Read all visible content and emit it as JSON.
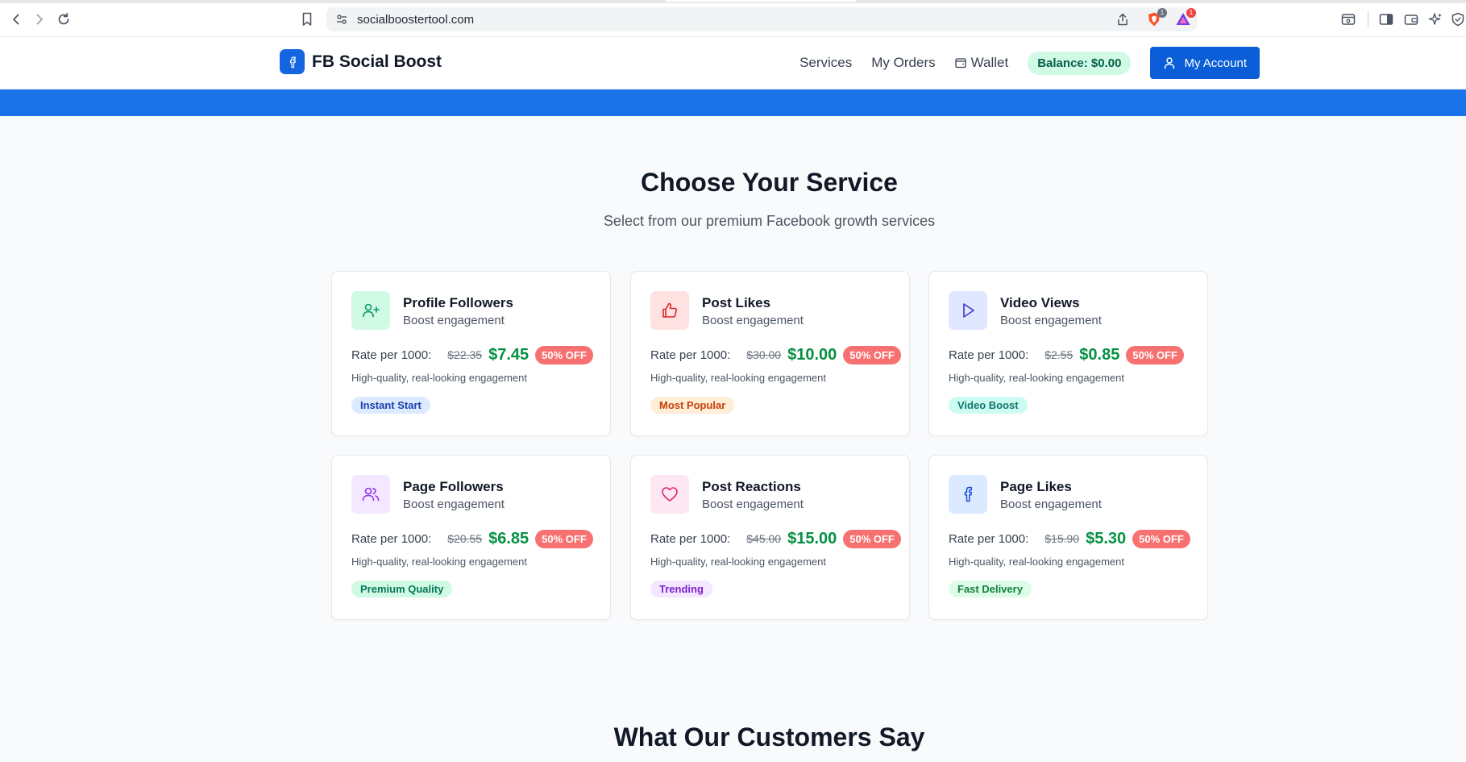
{
  "browser": {
    "url": "socialboostertool.com",
    "extension_badges": [
      "1",
      "1"
    ]
  },
  "site": {
    "brand": "FB Social Boost",
    "nav": {
      "services": "Services",
      "orders": "My Orders",
      "wallet": "Wallet",
      "balance": "Balance: $0.00",
      "account": "My Account"
    }
  },
  "services_section": {
    "title": "Choose Your Service",
    "subtitle": "Select from our premium Facebook growth services",
    "rate_label": "Rate per 1000:",
    "cards": [
      {
        "name": "Profile Followers",
        "desc": "Boost engagement",
        "old_price": "$22.35",
        "new_price": "$7.45",
        "discount": "50% OFF",
        "note": "High-quality, real-looking engagement",
        "tag": "Instant Start",
        "icon": "user-plus-icon",
        "icon_bg": "#d1fae5",
        "icon_color": "#059669",
        "tag_bg": "#dbeafe",
        "tag_color": "#1e40af"
      },
      {
        "name": "Post Likes",
        "desc": "Boost engagement",
        "old_price": "$30.00",
        "new_price": "$10.00",
        "discount": "50% OFF",
        "note": "High-quality, real-looking engagement",
        "tag": "Most Popular",
        "icon": "thumbs-up-icon",
        "icon_bg": "#fee2e2",
        "icon_color": "#dc2626",
        "tag_bg": "#ffedd5",
        "tag_color": "#c2410c"
      },
      {
        "name": "Video Views",
        "desc": "Boost engagement",
        "old_price": "$2.55",
        "new_price": "$0.85",
        "discount": "50% OFF",
        "note": "High-quality, real-looking engagement",
        "tag": "Video Boost",
        "icon": "play-icon",
        "icon_bg": "#e0e7ff",
        "icon_color": "#4338ca",
        "tag_bg": "#ccfbf1",
        "tag_color": "#0f766e"
      },
      {
        "name": "Page Followers",
        "desc": "Boost engagement",
        "old_price": "$20.55",
        "new_price": "$6.85",
        "discount": "50% OFF",
        "note": "High-quality, real-looking engagement",
        "tag": "Premium Quality",
        "icon": "users-icon",
        "icon_bg": "#f3e8ff",
        "icon_color": "#9333ea",
        "tag_bg": "#d1fae5",
        "tag_color": "#047857"
      },
      {
        "name": "Post Reactions",
        "desc": "Boost engagement",
        "old_price": "$45.00",
        "new_price": "$15.00",
        "discount": "50% OFF",
        "note": "High-quality, real-looking engagement",
        "tag": "Trending",
        "icon": "heart-icon",
        "icon_bg": "#fce7f3",
        "icon_color": "#db2777",
        "tag_bg": "#f3e8ff",
        "tag_color": "#7e22ce"
      },
      {
        "name": "Page Likes",
        "desc": "Boost engagement",
        "old_price": "$15.90",
        "new_price": "$5.30",
        "discount": "50% OFF",
        "note": "High-quality, real-looking engagement",
        "tag": "Fast Delivery",
        "icon": "facebook-icon",
        "icon_bg": "#dbeafe",
        "icon_color": "#1d4ed8",
        "tag_bg": "#dcfce7",
        "tag_color": "#15803d"
      }
    ]
  },
  "reviews_section": {
    "title": "What Our Customers Say"
  },
  "colors": {
    "brand_blue": "#1565e0",
    "hero_blue": "#1a73e8",
    "price_green": "#059142",
    "discount_red": "#f87171"
  }
}
